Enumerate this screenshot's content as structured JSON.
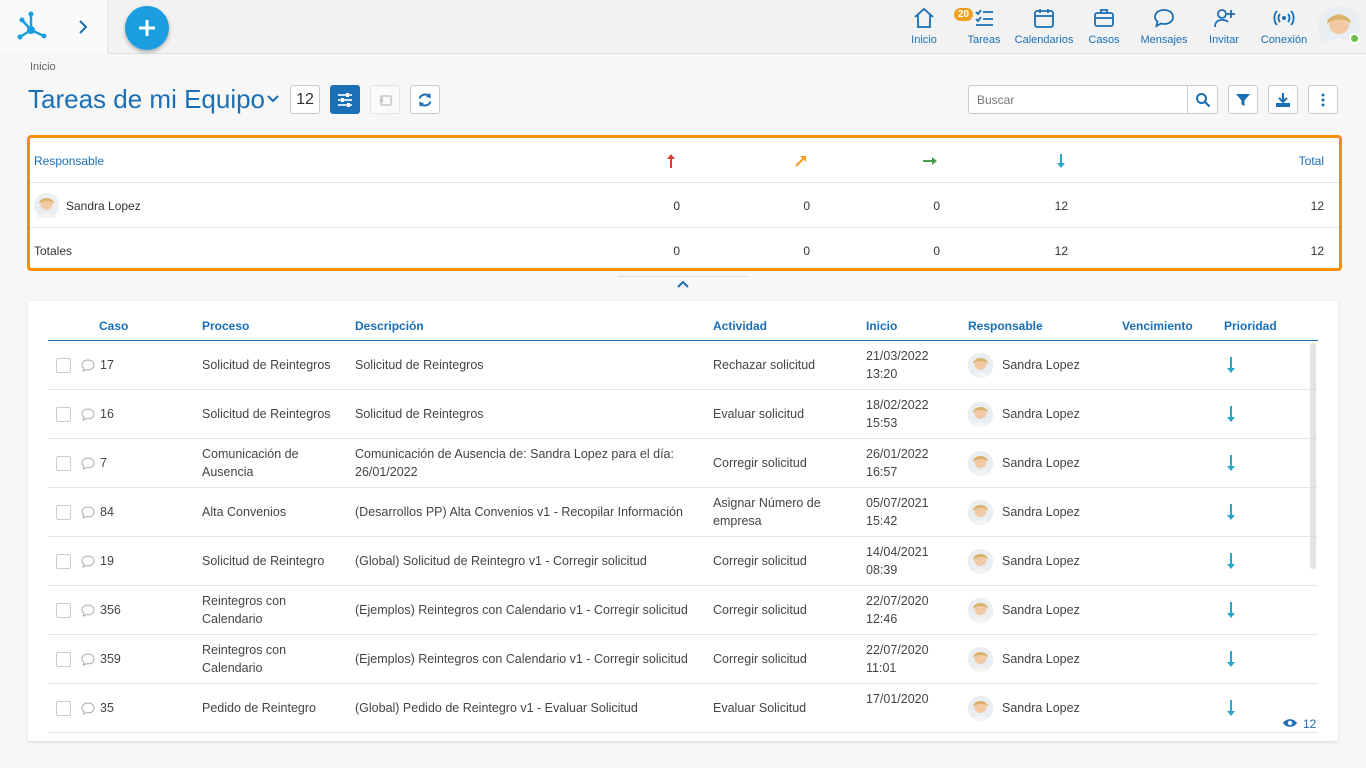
{
  "nav": {
    "items": [
      {
        "label": "Inicio",
        "icon": "home-icon"
      },
      {
        "label": "Tareas",
        "icon": "tasks-icon",
        "badge": "20"
      },
      {
        "label": "Calendarios",
        "icon": "calendar-icon"
      },
      {
        "label": "Casos",
        "icon": "briefcase-icon"
      },
      {
        "label": "Mensajes",
        "icon": "chat-icon"
      },
      {
        "label": "Invitar",
        "icon": "user-plus-icon"
      },
      {
        "label": "Conexión",
        "icon": "signal-icon"
      }
    ]
  },
  "breadcrumb": "Inicio",
  "page": {
    "title": "Tareas de mi Equipo",
    "count": "12"
  },
  "search": {
    "placeholder": "Buscar"
  },
  "summary": {
    "header": {
      "responsable": "Responsable",
      "total": "Total"
    },
    "rows": [
      {
        "name": "Sandra Lopez",
        "v1": "0",
        "v2": "0",
        "v3": "0",
        "v4": "12",
        "total": "12"
      },
      {
        "name": "Totales",
        "v1": "0",
        "v2": "0",
        "v3": "0",
        "v4": "12",
        "total": "12"
      }
    ]
  },
  "grid": {
    "columns": [
      "Caso",
      "Proceso",
      "Descripción",
      "Actividad",
      "Inicio",
      "Responsable",
      "Vencimiento",
      "Prioridad"
    ],
    "rows": [
      {
        "caso": "17",
        "proceso": "Solicitud de Reintegros",
        "descripcion": "Solicitud de Reintegros",
        "actividad": "Rechazar solicitud",
        "fecha": "21/03/2022",
        "hora": "13:20",
        "responsable": "Sandra Lopez"
      },
      {
        "caso": "16",
        "proceso": "Solicitud de Reintegros",
        "descripcion": "Solicitud de Reintegros",
        "actividad": "Evaluar solicitud",
        "fecha": "18/02/2022",
        "hora": "15:53",
        "responsable": "Sandra Lopez"
      },
      {
        "caso": "7",
        "proceso": "Comunicación de Ausencia",
        "descripcion": "Comunicación de Ausencia de: Sandra Lopez para el día: 26/01/2022",
        "actividad": "Corregir solicitud",
        "fecha": "26/01/2022",
        "hora": "16:57",
        "responsable": "Sandra Lopez"
      },
      {
        "caso": "84",
        "proceso": "Alta Convenios",
        "descripcion": "(Desarrollos PP) Alta Convenios v1 - Recopilar Información",
        "actividad": "Asignar Número de empresa",
        "fecha": "05/07/2021",
        "hora": "15:42",
        "responsable": "Sandra Lopez"
      },
      {
        "caso": "19",
        "proceso": "Solicitud de Reintegro",
        "descripcion": "(Global) Solicitud de Reintegro v1 - Corregir solicitud",
        "actividad": "Corregir solicitud",
        "fecha": "14/04/2021",
        "hora": "08:39",
        "responsable": "Sandra Lopez"
      },
      {
        "caso": "356",
        "proceso": "Reintegros con Calendario",
        "descripcion": "(Ejemplos) Reintegros con Calendario v1 - Corregir solicitud",
        "actividad": "Corregir solicitud",
        "fecha": "22/07/2020",
        "hora": "12:46",
        "responsable": "Sandra Lopez"
      },
      {
        "caso": "359",
        "proceso": "Reintegros con Calendario",
        "descripcion": "(Ejemplos) Reintegros con Calendario v1 - Corregir solicitud",
        "actividad": "Corregir solicitud",
        "fecha": "22/07/2020",
        "hora": "11:01",
        "responsable": "Sandra Lopez"
      },
      {
        "caso": "35",
        "proceso": "Pedido de Reintegro",
        "descripcion": "(Global) Pedido de Reintegro v1 - Evaluar Solicitud",
        "actividad": "Evaluar Solicitud",
        "fecha": "17/01/2020",
        "hora": "",
        "responsable": "Sandra Lopez"
      }
    ],
    "footer_count": "12"
  },
  "colors": {
    "primary": "#1a6fb5",
    "accent": "#1a9ee0",
    "highlight": "#f5900a",
    "urgent": "#e53935",
    "high": "#f0a020",
    "normal": "#43a047",
    "low": "#26a9c9"
  }
}
